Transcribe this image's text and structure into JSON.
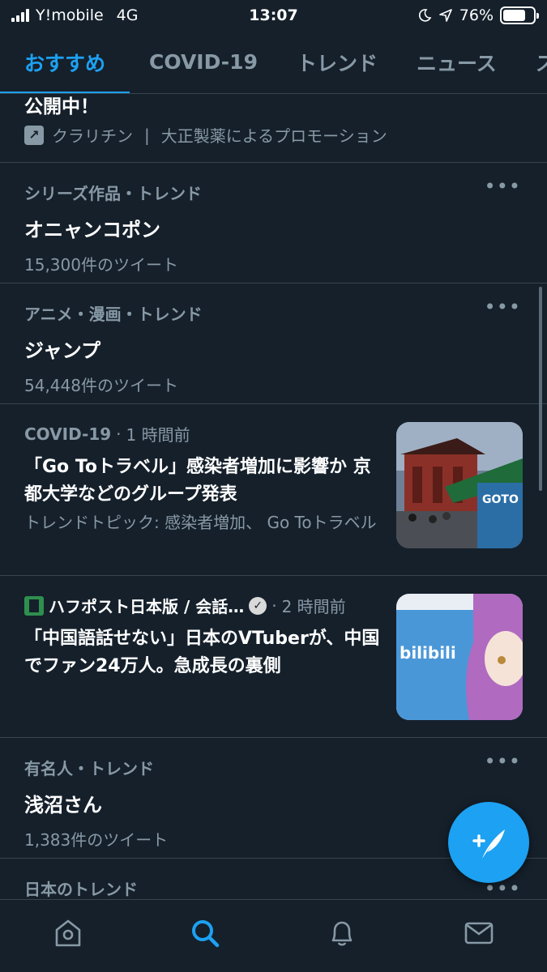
{
  "status_bar": {
    "carrier": "Y!mobile",
    "network": "4G",
    "time": "13:07",
    "battery": "76%",
    "battery_level": 0.76
  },
  "tabs": [
    {
      "label": "おすすめ",
      "active": true
    },
    {
      "label": "COVID-19",
      "active": false
    },
    {
      "label": "トレンド",
      "active": false
    },
    {
      "label": "ニュース",
      "active": false
    },
    {
      "label": "ス",
      "active": false
    }
  ],
  "promo": {
    "title": "公開中！",
    "advertiser": "クラリチン",
    "promotion_text": "大正製薬によるプロモーション"
  },
  "trends": [
    {
      "meta": "シリーズ作品・トレンド",
      "name": "オニャンコポン",
      "count": "15,300件のツイート"
    },
    {
      "meta": "アニメ・漫画・トレンド",
      "name": "ジャンプ",
      "count": "54,448件のツイート"
    }
  ],
  "stories": [
    {
      "source": "COVID-19",
      "time": "1 時間前",
      "headline": "「Go Toトラベル」感染者増加に影響か 京都大学などのグループ発表",
      "topic": "トレンドトピック: 感染者増加、 Go Toトラベル",
      "thumb_text": "GOTO トラベル"
    },
    {
      "source": "ハフポスト日本版 / 会話…",
      "time": "2 時間前",
      "headline": "「中国語話せない」日本のVTuberが、中国でファン24万人。急成長の裏側",
      "thumb_text": "bilibili"
    }
  ],
  "trends_after": [
    {
      "meta": "有名人・トレンド",
      "name": "浅沼さん",
      "count": "1,383件のツイート"
    },
    {
      "meta": "日本のトレンド",
      "name": "",
      "count": ""
    }
  ],
  "more_label": "•••",
  "separator": "|",
  "dot": "·",
  "verified_mark": "✓",
  "colors": {
    "background": "#15202b",
    "accent": "#1da1f2",
    "muted": "#8899a6",
    "border": "#38444d"
  },
  "icons": {
    "fab": "compose-tweet-icon",
    "nav": [
      "home-icon",
      "search-icon",
      "notifications-icon",
      "messages-icon"
    ]
  }
}
